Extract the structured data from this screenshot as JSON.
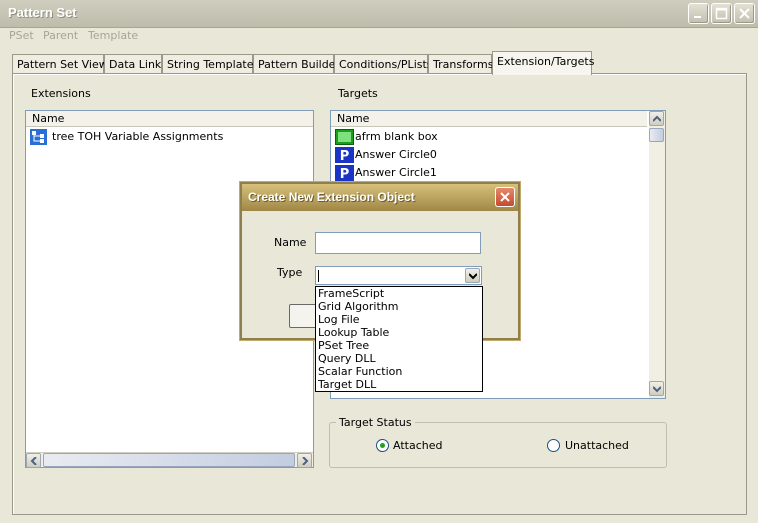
{
  "window": {
    "title": "Pattern Set"
  },
  "menu": [
    "PSet",
    "Parent",
    "Template"
  ],
  "tabs": [
    {
      "label": "Pattern Set View"
    },
    {
      "label": "Data Link"
    },
    {
      "label": "String Templates"
    },
    {
      "label": "Pattern Builder"
    },
    {
      "label": "Conditions/PLists"
    },
    {
      "label": "Transforms"
    },
    {
      "label": "Extension/Targets"
    }
  ],
  "active_tab": "Extension/Targets",
  "extensions": {
    "label": "Extensions",
    "column": "Name",
    "items": [
      {
        "name": "tree TOH Variable Assignments",
        "icon": "tree-icon"
      }
    ]
  },
  "targets": {
    "label": "Targets",
    "column": "Name",
    "items": [
      {
        "name": "afrm blank box",
        "icon": "green-box-icon"
      },
      {
        "name": "Answer Circle0",
        "icon": "blue-p-icon"
      },
      {
        "name": "Answer Circle1",
        "icon": "blue-p-icon"
      }
    ]
  },
  "target_status": {
    "label": "Target Status",
    "attached": "Attached",
    "unattached": "Unattached",
    "selected": "Attached"
  },
  "dialog": {
    "title": "Create New Extension Object",
    "name_label": "Name",
    "name_value": "",
    "type_label": "Type",
    "type_value": "",
    "type_options": [
      "FrameScript",
      "Grid Algorithm",
      "Log File",
      "Lookup Table",
      "PSet Tree",
      "Query DLL",
      "Scalar Function",
      "Target DLL"
    ]
  },
  "colors": {
    "dialog_title": "#b59c54",
    "tab_panel": "#e9e7d8",
    "list_border": "#7f9db9",
    "close_button": "#d9684a"
  }
}
